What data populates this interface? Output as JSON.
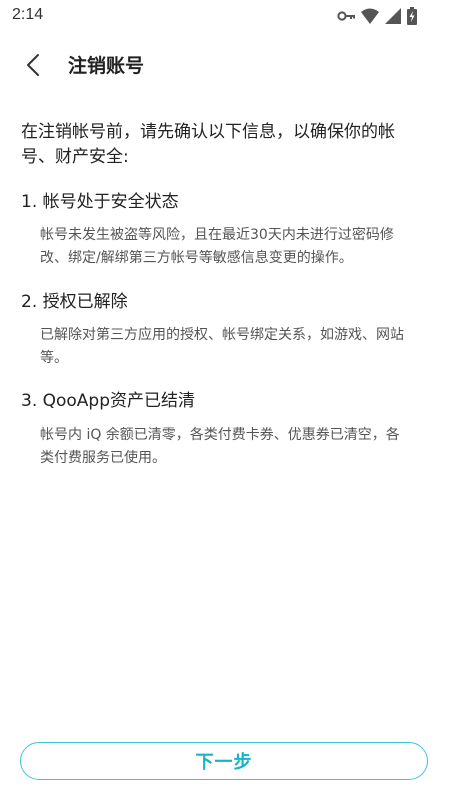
{
  "status_bar": {
    "time": "2:14",
    "icons": [
      "key-icon",
      "wifi-icon",
      "signal-icon",
      "battery-charging-icon"
    ]
  },
  "header": {
    "back_icon": "chevron-left-icon",
    "title": "注销账号"
  },
  "intro": {
    "line1": "在注销帐号前，请先确认以下信息，以确保你的帐",
    "line2": "号、财产安全:"
  },
  "sections": [
    {
      "title": "1. 帐号处于安全状态",
      "desc_line1": "帐号未发生被盗等风险，且在最近30天内未进行过密码修",
      "desc_line2": "改、绑定/解绑第三方帐号等敏感信息变更的操作。"
    },
    {
      "title": "2. 授权已解除",
      "desc_line1": "已解除对第三方应用的授权、帐号绑定关系，如游戏、网站",
      "desc_line2": "等。"
    },
    {
      "title": "3. QooApp资产已结清",
      "desc_line1": "帐号内 iQ 余额已清零，各类付费卡券、优惠券已清空，各",
      "desc_line2": "类付费服务已使用。"
    }
  ],
  "footer": {
    "next_label": "下一步"
  },
  "colors": {
    "accent": "#19b3c7",
    "button_border": "#3ec6d8",
    "text_primary": "#222222",
    "text_secondary": "#555555"
  }
}
